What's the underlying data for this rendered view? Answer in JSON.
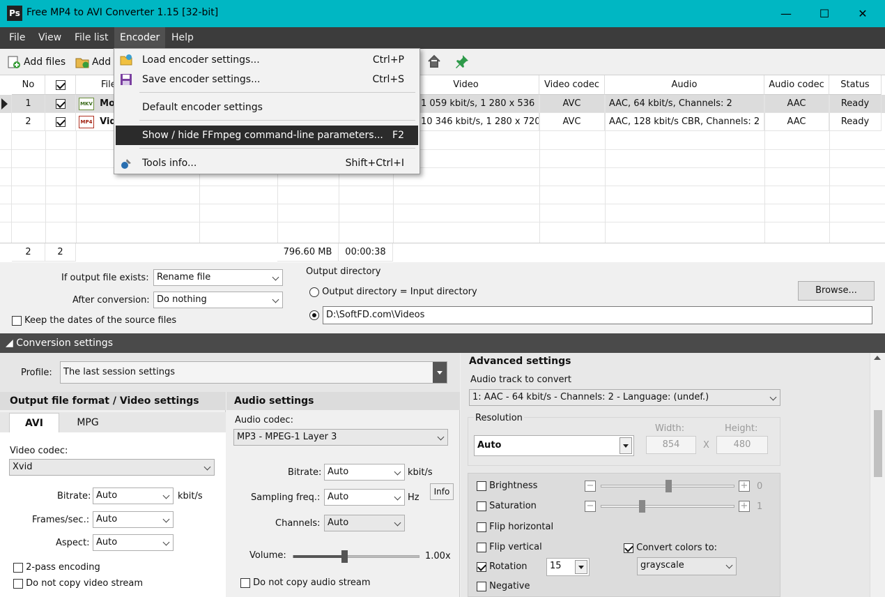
{
  "window": {
    "title": "Free MP4 to AVI Converter 1.15  [32-bit]",
    "logo": "Ps"
  },
  "menu": [
    "File",
    "View",
    "File list",
    "Encoder",
    "Help"
  ],
  "toolbar": {
    "add_files": "Add files",
    "add_folder": "Add"
  },
  "encoder_menu": [
    {
      "label": "Load encoder settings...",
      "shortcut": "Ctrl+P",
      "icon": "folder-open-icon"
    },
    {
      "label": "Save encoder settings...",
      "shortcut": "Ctrl+S",
      "icon": "save-icon"
    },
    {
      "label": "Default encoder settings",
      "shortcut": "",
      "icon": ""
    },
    {
      "label": "Show / hide FFmpeg command-line parameters...",
      "shortcut": "F2",
      "icon": ""
    },
    {
      "label": "Tools info...",
      "shortcut": "Shift+Ctrl+I",
      "icon": "tools-icon"
    }
  ],
  "grid": {
    "headers": {
      "no": "No",
      "file": "File",
      "video": "Video",
      "video_codec": "Video codec",
      "audio": "Audio",
      "audio_codec": "Audio codec",
      "status": "Status"
    },
    "rows": [
      {
        "no": "1",
        "name": "Mo",
        "badge": "MKV",
        "video": "1 059 kbit/s, 1 280 x 536",
        "video_codec": "AVC",
        "audio": "AAC, 64 kbit/s, Channels: 2",
        "audio_codec": "AAC",
        "status": "Ready"
      },
      {
        "no": "2",
        "name": "Vid",
        "badge": "MP4",
        "video": "10 346 kbit/s, 1 280 x 720",
        "video_codec": "AVC",
        "audio": "AAC, 128 kbit/s CBR, Channels: 2",
        "audio_codec": "AAC",
        "status": "Ready"
      }
    ],
    "summary": {
      "count": "2",
      "checked": "2",
      "size": "796.60 MB",
      "duration": "00:00:38"
    }
  },
  "output": {
    "if_exists_label": "If output file exists:",
    "if_exists_value": "Rename file",
    "after_label": "After conversion:",
    "after_value": "Do nothing",
    "keep_dates": "Keep the dates of the source files",
    "dir_label": "Output directory",
    "dir_same": "Output directory = Input directory",
    "dir_path": "D:\\SoftFD.com\\Videos",
    "browse": "Browse..."
  },
  "conversion": {
    "title": "Conversion settings",
    "profile_label": "Profile:",
    "profile_value": "The last session settings"
  },
  "video": {
    "title": "Output file format / Video settings",
    "tabs": [
      "AVI",
      "MPG"
    ],
    "codec_label": "Video codec:",
    "codec_value": "Xvid",
    "bitrate_label": "Bitrate:",
    "bitrate_value": "Auto",
    "bitrate_unit": "kbit/s",
    "fps_label": "Frames/sec.:",
    "fps_value": "Auto",
    "aspect_label": "Aspect:",
    "aspect_value": "Auto",
    "two_pass": "2-pass encoding",
    "no_copy_video": "Do not copy video stream"
  },
  "audio": {
    "title": "Audio settings",
    "codec_label": "Audio codec:",
    "codec_value": "MP3 - MPEG-1 Layer 3",
    "bitrate_label": "Bitrate:",
    "bitrate_value": "Auto",
    "bitrate_unit": "kbit/s",
    "freq_label": "Sampling freq.:",
    "freq_value": "Auto",
    "freq_unit": "Hz",
    "info": "Info",
    "channels_label": "Channels:",
    "channels_value": "Auto",
    "volume_label": "Volume:",
    "volume_value": "1.00x",
    "volume_level": 0.4,
    "no_copy_audio": "Do not copy audio stream"
  },
  "advanced": {
    "title": "Advanced settings",
    "track_label": "Audio track to convert",
    "track_value": "1: AAC - 64 kbit/s - Channels: 2 - Language: (undef.)",
    "resolution_label": "Resolution",
    "resolution_value": "Auto",
    "width_label": "Width:",
    "width_value": "854",
    "height_label": "Height:",
    "height_value": "480",
    "times": "X",
    "brightness": "Brightness",
    "brightness_value": "0",
    "saturation": "Saturation",
    "saturation_value": "1",
    "flip_h": "Flip horizontal",
    "flip_v": "Flip vertical",
    "rotation": "Rotation",
    "rotation_value": "15",
    "negative": "Negative",
    "convert_colors": "Convert colors to:",
    "convert_colors_value": "grayscale",
    "minus": "−",
    "plus": "+"
  },
  "colors": {
    "titlebar": "#00b7c3",
    "menubar": "#3c3c3c",
    "convbar": "#4a4a4a"
  }
}
